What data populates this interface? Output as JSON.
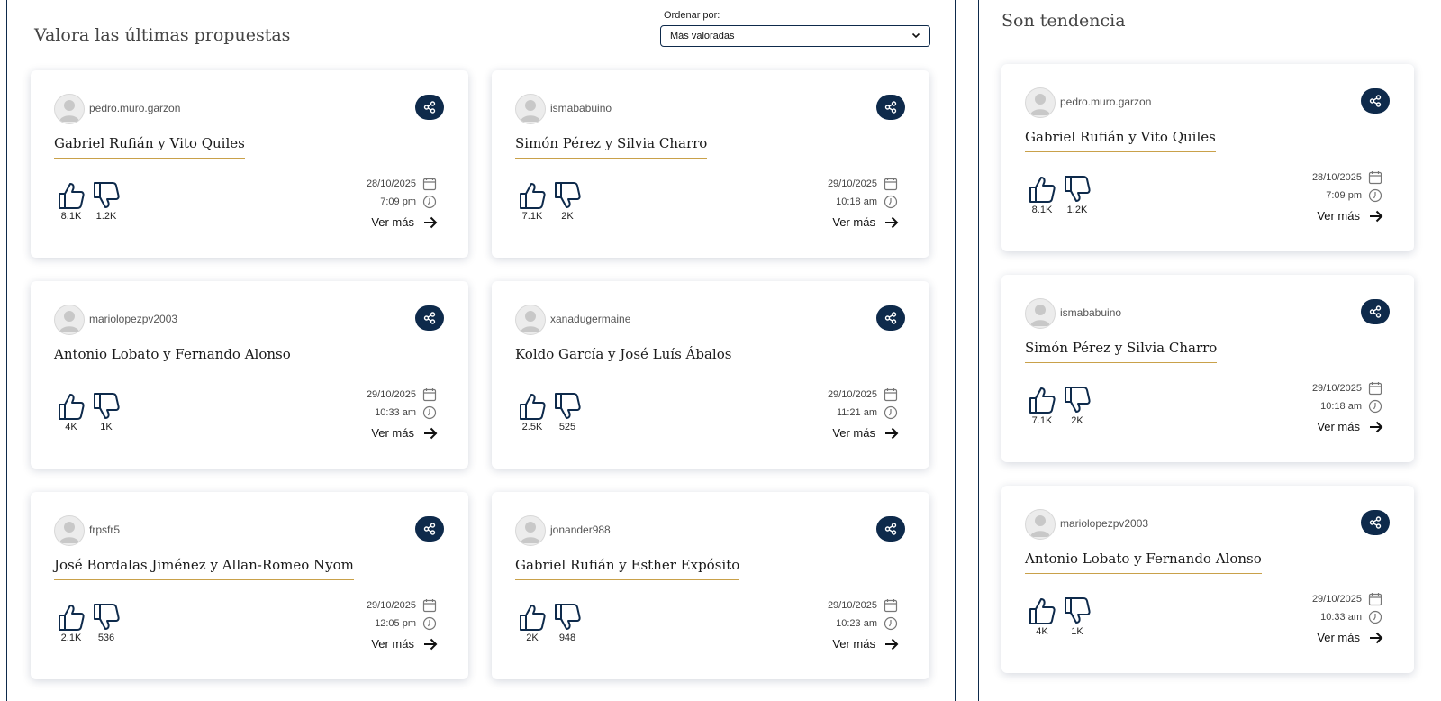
{
  "main": {
    "title": "Valora las últimas propuestas",
    "sort_label": "Ordenar por:",
    "sort_value": "Más valoradas"
  },
  "trending": {
    "title": "Son tendencia"
  },
  "common": {
    "ver_mas": "Ver más"
  },
  "colors": {
    "navy": "#0e2a4b",
    "gold_underline": "#c9a14a"
  },
  "icons": [
    "share-icon",
    "thumbs-up-icon",
    "thumbs-down-icon",
    "calendar-icon",
    "clock-icon",
    "arrow-right-icon",
    "chevron-down-icon",
    "avatar-icon"
  ],
  "proposals": [
    {
      "user": "pedro.muro.garzon",
      "title": "Gabriel Rufián y Vito Quiles",
      "likes": "8.1K",
      "dislikes": "1.2K",
      "date": "28/10/2025",
      "time": "7:09 pm"
    },
    {
      "user": "ismababuino",
      "title": "Simón Pérez y Silvia Charro",
      "likes": "7.1K",
      "dislikes": "2K",
      "date": "29/10/2025",
      "time": "10:18 am"
    },
    {
      "user": "mariolopezpv2003",
      "title": "Antonio Lobato y Fernando Alonso",
      "likes": "4K",
      "dislikes": "1K",
      "date": "29/10/2025",
      "time": "10:33 am"
    },
    {
      "user": "xanadugermaine",
      "title": "Koldo García y José Luís Ábalos",
      "likes": "2.5K",
      "dislikes": "525",
      "date": "29/10/2025",
      "time": "11:21 am"
    },
    {
      "user": "frpsfr5",
      "title": "José Bordalas Jiménez y Allan-Romeo Nyom",
      "likes": "2.1K",
      "dislikes": "536",
      "date": "29/10/2025",
      "time": "12:05 pm"
    },
    {
      "user": "jonander988",
      "title": "Gabriel Rufián y Esther Expósito",
      "likes": "2K",
      "dislikes": "948",
      "date": "29/10/2025",
      "time": "10:23 am"
    }
  ],
  "trending_items": [
    {
      "user": "pedro.muro.garzon",
      "title": "Gabriel Rufián y Vito Quiles",
      "likes": "8.1K",
      "dislikes": "1.2K",
      "date": "28/10/2025",
      "time": "7:09 pm"
    },
    {
      "user": "ismababuino",
      "title": "Simón Pérez y Silvia Charro",
      "likes": "7.1K",
      "dislikes": "2K",
      "date": "29/10/2025",
      "time": "10:18 am"
    },
    {
      "user": "mariolopezpv2003",
      "title": "Antonio Lobato y Fernando Alonso",
      "likes": "4K",
      "dislikes": "1K",
      "date": "29/10/2025",
      "time": "10:33 am"
    }
  ]
}
